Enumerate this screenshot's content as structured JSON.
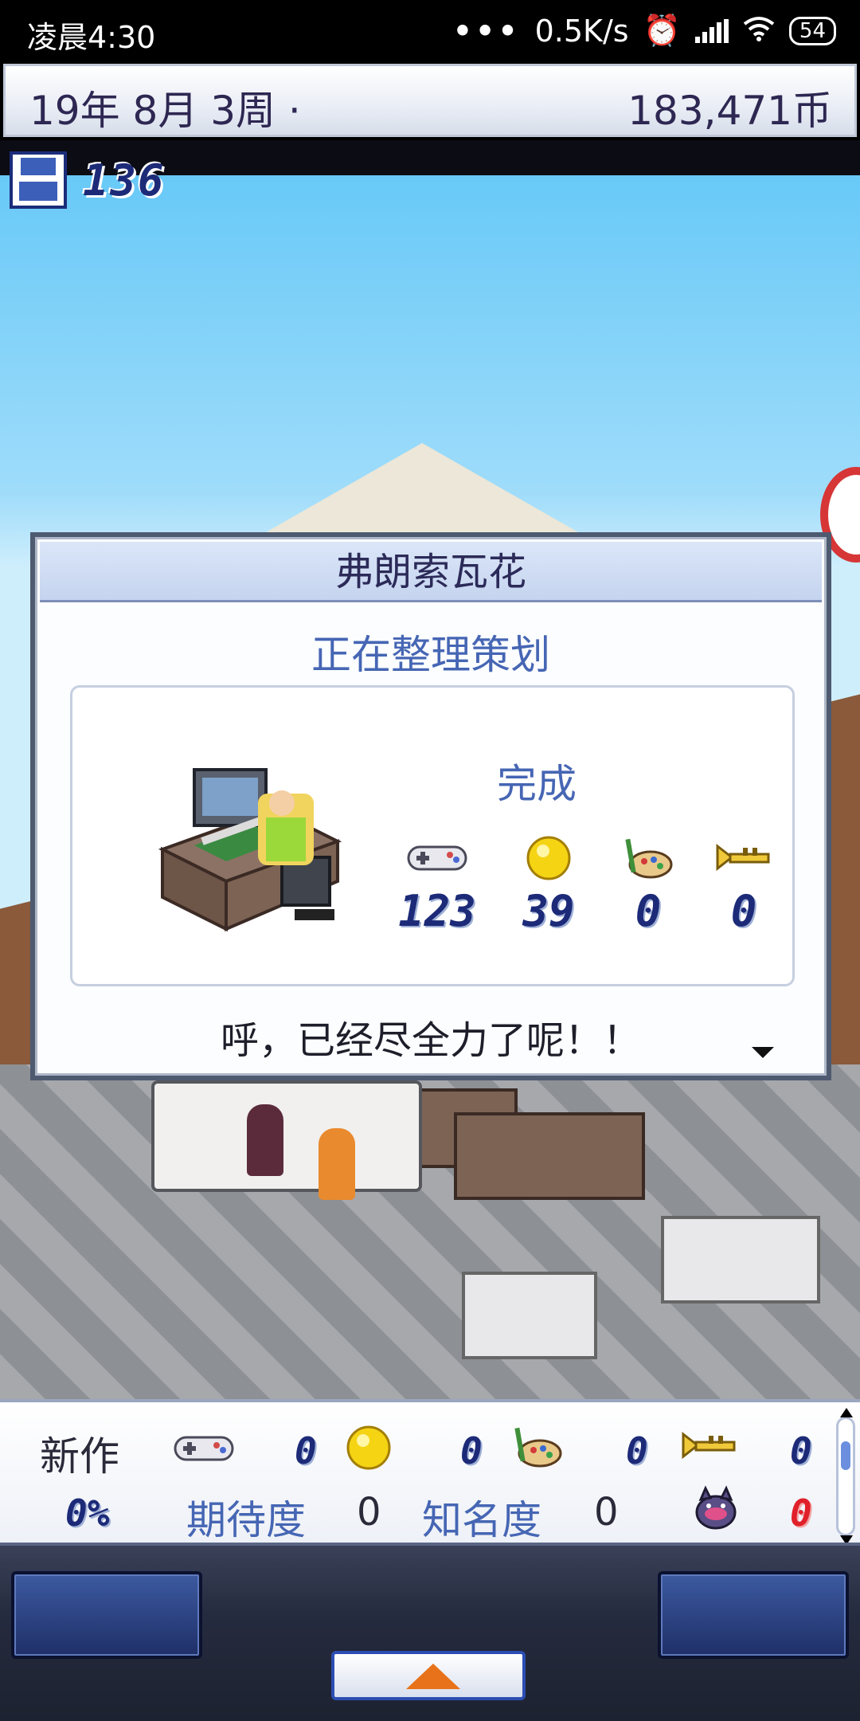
{
  "status_bar": {
    "time": "凌晨4:30",
    "dots": "•••",
    "network_speed": "0.5K/s",
    "battery": "54"
  },
  "top_bar": {
    "date": "19年 8月 3周 ·",
    "money": "183,471币"
  },
  "save_counter": {
    "value": "136"
  },
  "dialog": {
    "character_name": "弗朗索瓦花",
    "status": "正在整理策划",
    "result_label": "完成",
    "stats": [
      {
        "icon": "gamepad-icon",
        "value": "123"
      },
      {
        "icon": "gold-coin-icon",
        "value": "39"
      },
      {
        "icon": "paint-palette-icon",
        "value": "0"
      },
      {
        "icon": "trumpet-icon",
        "value": "0"
      }
    ],
    "message": "呼，已经尽全力了呢！！"
  },
  "info_panel": {
    "new_work_label": "新作",
    "stats": [
      {
        "icon": "gamepad-icon",
        "value": "0"
      },
      {
        "icon": "gold-coin-icon",
        "value": "0"
      },
      {
        "icon": "paint-palette-icon",
        "value": "0"
      },
      {
        "icon": "trumpet-icon",
        "value": "0"
      }
    ],
    "progress": "0%",
    "expectation_label": "期待度",
    "expectation_value": "0",
    "fame_label": "知名度",
    "fame_value": "0",
    "bug_value": "0"
  },
  "colors": {
    "accent_blue": "#4666b4",
    "number_navy": "#1c2a78",
    "bug_red": "#e0202a",
    "up_arrow_orange": "#e8721a"
  }
}
